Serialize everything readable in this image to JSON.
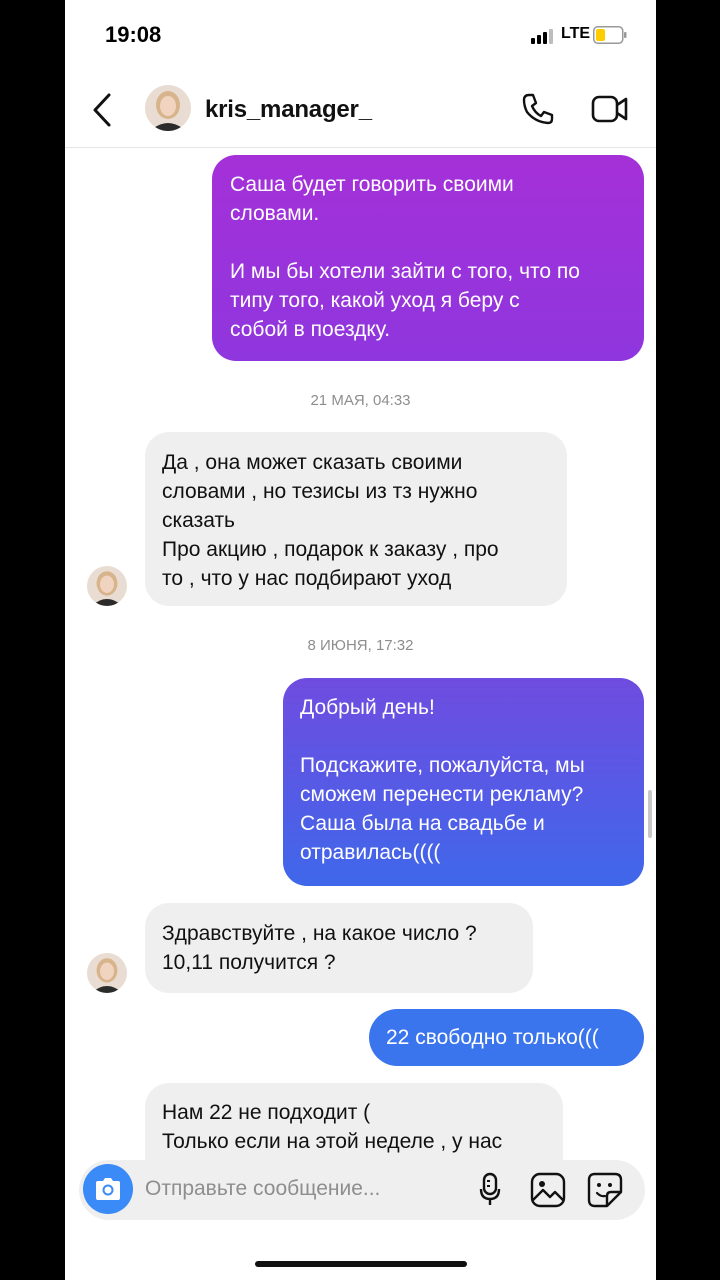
{
  "status_bar": {
    "time": "19:08",
    "network": "LTE"
  },
  "header": {
    "username": "kris_manager_"
  },
  "messages": [
    {
      "type": "out",
      "text": "Саша будет говорить своими\nсловами.\n\nИ мы бы хотели зайти с того, что по\nтипу того, какой уход я беру с\nсобой в поездку."
    },
    {
      "type": "timestamp",
      "text": "21 МАЯ, 04:33"
    },
    {
      "type": "in",
      "text": "Да , она может сказать своими\nсловами , но тезисы из тз нужно\nсказать\nПро акцию , подарок к заказу , про\nто , что у нас подбирают уход"
    },
    {
      "type": "timestamp",
      "text": "8 ИЮНЯ, 17:32"
    },
    {
      "type": "out",
      "text": "Добрый день!\n\nПодскажите, пожалуйста, мы\nсможем перенести рекламу?\nСаша была на свадьбе и\nотравилась(((("
    },
    {
      "type": "in",
      "text": "Здравствуйте , на какое число ?\n10,11 получится ?"
    },
    {
      "type": "out",
      "text": "22 свободно только((("
    },
    {
      "type": "in",
      "text": "Нам 22 не подходит (\nТолько если на этой неделе , у нас"
    }
  ],
  "composer": {
    "placeholder": "Отправьте сообщение..."
  },
  "icons": [
    "back-icon",
    "phone-icon",
    "video-camera-icon",
    "camera-icon",
    "microphone-icon",
    "gallery-icon",
    "sticker-icon"
  ],
  "colors": {
    "bubble_gradient_top": "#a532d8",
    "bubble_gradient_bottom": "#3a78f0",
    "incoming_bubble": "#efefef",
    "camera_button": "#3a8af8"
  }
}
